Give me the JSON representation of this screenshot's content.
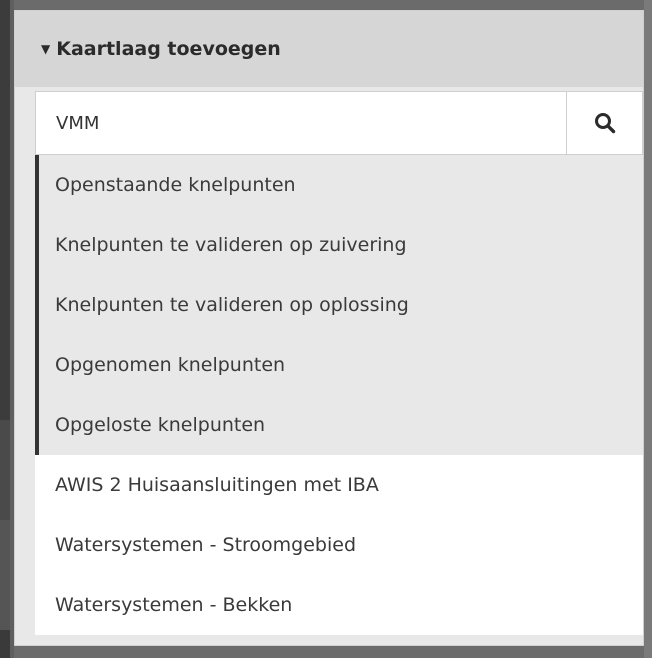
{
  "panel": {
    "title": "Kaartlaag toevoegen"
  },
  "search": {
    "value": "VMM",
    "icon": "search-icon"
  },
  "results": {
    "highlighted": [
      "Openstaande knelpunten",
      "Knelpunten te valideren op zuivering",
      "Knelpunten te valideren op oplossing",
      "Opgenomen knelpunten",
      "Opgeloste knelpunten"
    ],
    "other": [
      "AWIS 2 Huisaansluitingen met IBA",
      "Watersystemen - Stroomgebied",
      "Watersystemen - Bekken"
    ]
  },
  "colors": {
    "header_bg": "#d6d6d6",
    "highlight_bg": "#e8e8e8",
    "highlight_border": "#333333",
    "text": "#3a3a3a"
  }
}
